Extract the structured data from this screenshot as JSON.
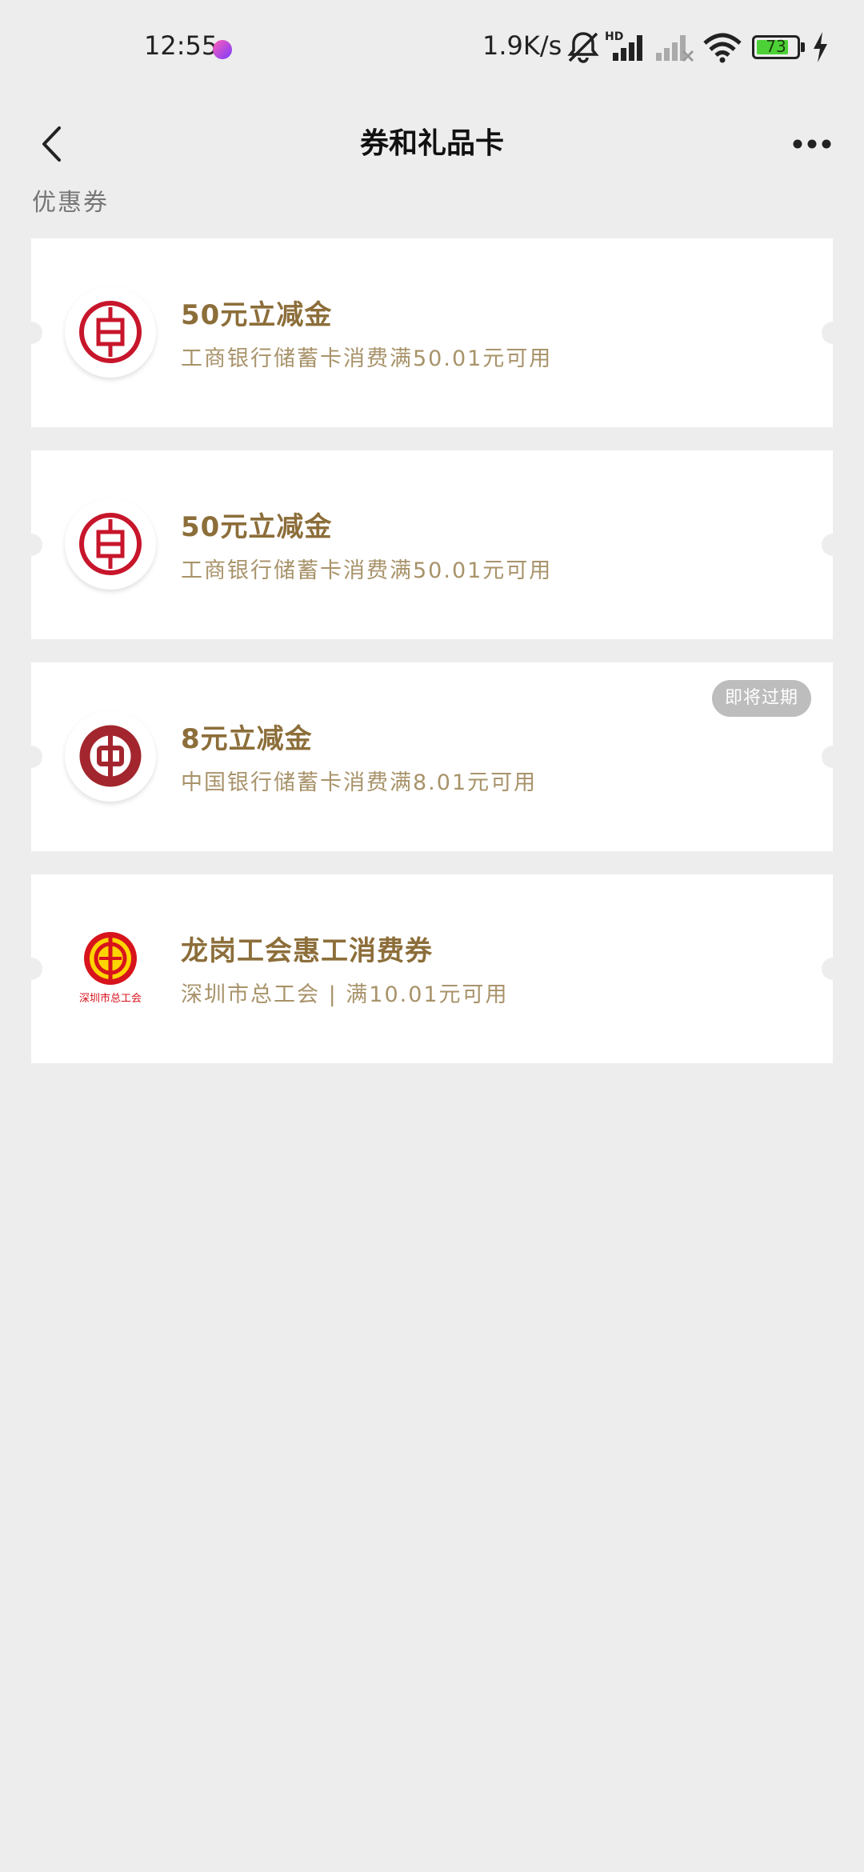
{
  "status_bar": {
    "time": "12:55",
    "app_icon": "app-badge-icon",
    "network_speed": "1.9K/s",
    "battery_level": "73",
    "icons": [
      "mute-bell-icon",
      "hd-signal-icon",
      "signal-no-service-icon",
      "wifi-icon",
      "battery-icon",
      "charging-bolt-icon"
    ]
  },
  "nav": {
    "title": "券和礼品卡",
    "back_icon": "chevron-left-icon",
    "more_icon": "more-dots-icon"
  },
  "section": {
    "label": "优惠券"
  },
  "coupons": [
    {
      "title": "50元立减金",
      "desc": "工商银行储蓄卡消费满50.01元可用",
      "logo": "icbc-logo-icon"
    },
    {
      "title": "50元立减金",
      "desc": "工商银行储蓄卡消费满50.01元可用",
      "logo": "icbc-logo-icon"
    },
    {
      "title": "8元立减金",
      "desc": "中国银行储蓄卡消费满8.01元可用",
      "logo": "boc-logo-icon",
      "badge": "即将过期"
    },
    {
      "title": "龙岗工会惠工消费券",
      "desc": "深圳市总工会 | 满10.01元可用",
      "logo": "trade-union-logo-icon",
      "logo_caption": "深圳市总工会"
    }
  ],
  "colors": {
    "background": "#ededed",
    "card_title": "#8c6e3a",
    "card_desc": "#a8936a",
    "icbc_red": "#c7162b",
    "boc_red": "#a3262e",
    "badge_bg": "#bdbdbd"
  }
}
